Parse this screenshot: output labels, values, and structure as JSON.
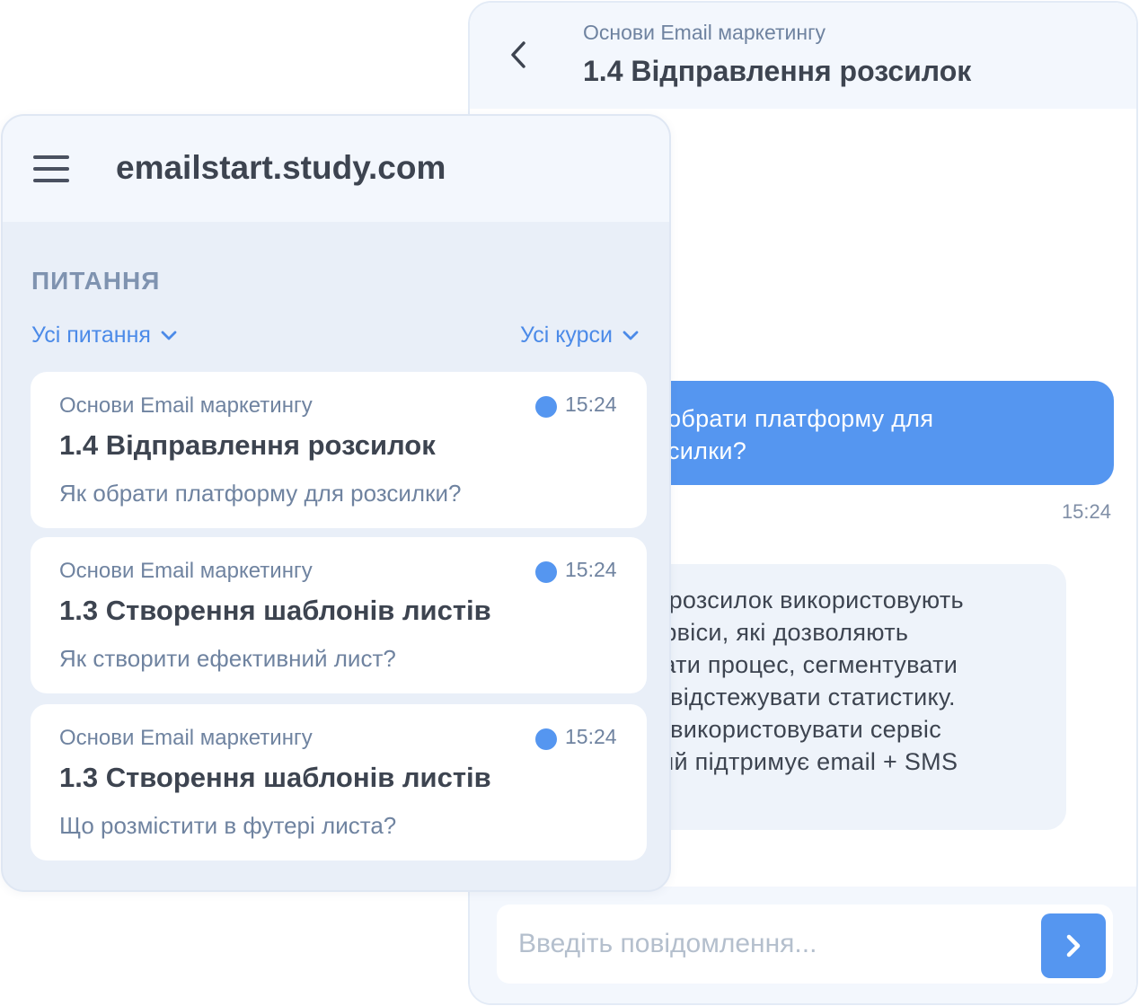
{
  "chat": {
    "course": "Основи Email маркетингу",
    "lesson": "1.4 Відправлення розсилок",
    "outgoing_message": {
      "lines": [
        "обрати платформу для",
        "силки?"
      ],
      "time": "15:24"
    },
    "incoming_message": {
      "lines": [
        "х розсилок використовують",
        "ервіси, які дозволяють",
        "вати процес, сегментувати",
        "а відстежувати статистику.",
        "о використовувати сервіс",
        "кий підтримує email + SMS"
      ]
    },
    "input_placeholder": "Введіть повідомлення...",
    "icons": {
      "back": "chevron-left-icon",
      "send": "chevron-right-icon"
    }
  },
  "questions_panel": {
    "site_title": "emailstart.study.com",
    "section_heading": "ПИТАННЯ",
    "filter_questions": "Усі питання",
    "filter_courses": "Усі курси",
    "icons": {
      "menu": "hamburger-menu-icon",
      "dropdown": "chevron-down-icon",
      "unread": "unread-dot-icon"
    },
    "items": [
      {
        "course": "Основи Email маркетингу",
        "lesson": "1.4 Відправлення розсилок",
        "question": "Як обрати платформу для розсилки?",
        "time": "15:24"
      },
      {
        "course": "Основи Email маркетингу",
        "lesson": "1.3 Створення шаблонів листів",
        "question": "Як створити ефективний лист?",
        "time": "15:24"
      },
      {
        "course": "Основи Email маркетингу",
        "lesson": "1.3 Створення шаблонів листів",
        "question": "Що розмістити в футері листа?",
        "time": "15:24"
      }
    ]
  },
  "colors": {
    "accent": "#5596f0",
    "link": "#4b8ae8",
    "text_dark": "#3d4450",
    "text_muted": "#6f83a0",
    "panel_bg": "#e9eff8",
    "header_bg": "#f3f7fd"
  }
}
